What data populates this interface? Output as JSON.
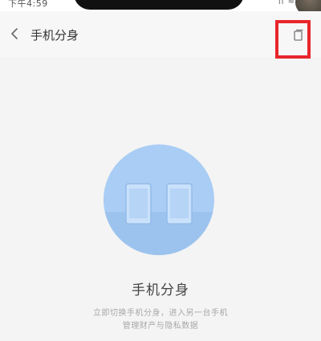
{
  "status_bar": {
    "time": "下午4:59",
    "icons": "ıl ≈"
  },
  "header": {
    "title": "手机分身",
    "back_icon": "chevron-left-icon",
    "action_icon": "clone-icon"
  },
  "hero": {
    "icon": "dual-phone-icon",
    "circle_color": "#a9cdf5"
  },
  "main": {
    "title": "手机分身",
    "description_line1": "立即切换手机分身，进入另一台手机",
    "description_line2": "管理财产与隐私数据"
  },
  "colors": {
    "highlight": "#e8252b",
    "background": "#f4f4f4"
  }
}
